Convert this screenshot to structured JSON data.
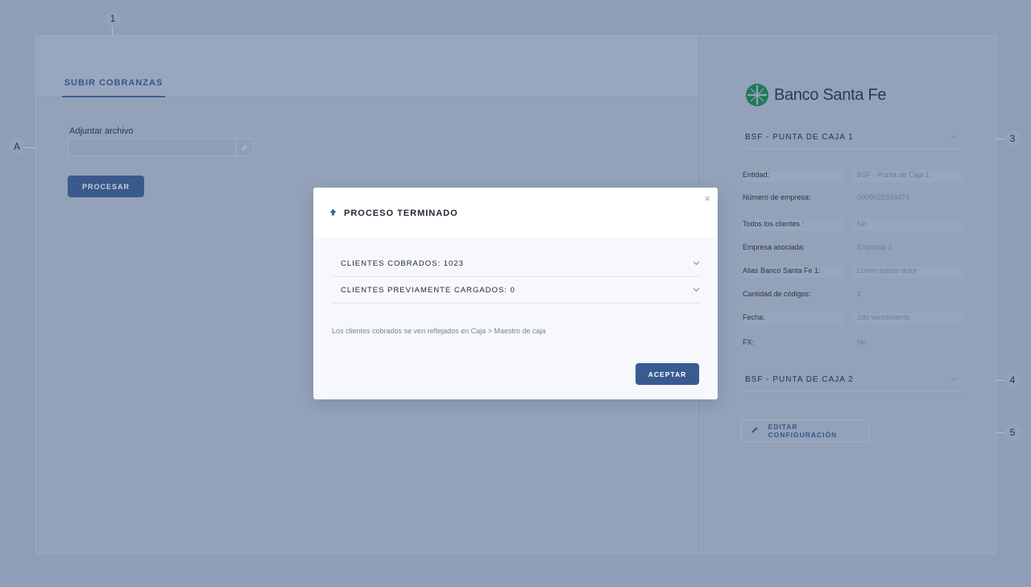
{
  "annotations": {
    "a1": "1",
    "aA": "A",
    "a3": "3",
    "a4": "4",
    "a5": "5"
  },
  "left_pane": {
    "tab_label": "SUBIR COBRANZAS",
    "attach_label": "Adjuntar archivo",
    "attach_icon": "paperclip-icon",
    "process_button": "PROCESAR"
  },
  "right_pane": {
    "logo_text": "Banco Santa Fe",
    "logo_color": "#1f8a5a",
    "section1": {
      "title": "BSF - PUNTA DE CAJA 1",
      "expanded": true,
      "fields": [
        {
          "label": "Entidad:",
          "value": "BSF - Punta de Caja 1"
        },
        {
          "label": "Número de empresa:",
          "value": "0009029393474"
        },
        {
          "label": "Todos los clientes :",
          "value": "No"
        },
        {
          "label": "Empresa asociada:",
          "value": "Empresa 1"
        },
        {
          "label": "Alias Banco Santa Fe 1:",
          "value": "Lorem ipsum dolor"
        },
        {
          "label": "Cantidad de códigos:",
          "value": "1"
        },
        {
          "label": "Fecha:",
          "value": "2do vencimiento"
        },
        {
          "label": "FX:",
          "value": "No"
        }
      ]
    },
    "section2": {
      "title": "BSF - PUNTA DE CAJA 2",
      "expanded": false
    },
    "edit_button": "EDITAR CONFIGURACIÓN"
  },
  "modal": {
    "title": "PROCESO TERMINADO",
    "close_glyph": "×",
    "rows": [
      {
        "label": "CLIENTES COBRADOS: 1023"
      },
      {
        "label": "CLIENTES PREVIAMENTE CARGADOS: 0"
      }
    ],
    "note": "Los clientes cobrados se ven reflejados en Caja > Maestro de caja",
    "accept_button": "ACEPTAR"
  },
  "colors": {
    "accent": "#3a5b92",
    "overlay": "#8e9eb6"
  }
}
